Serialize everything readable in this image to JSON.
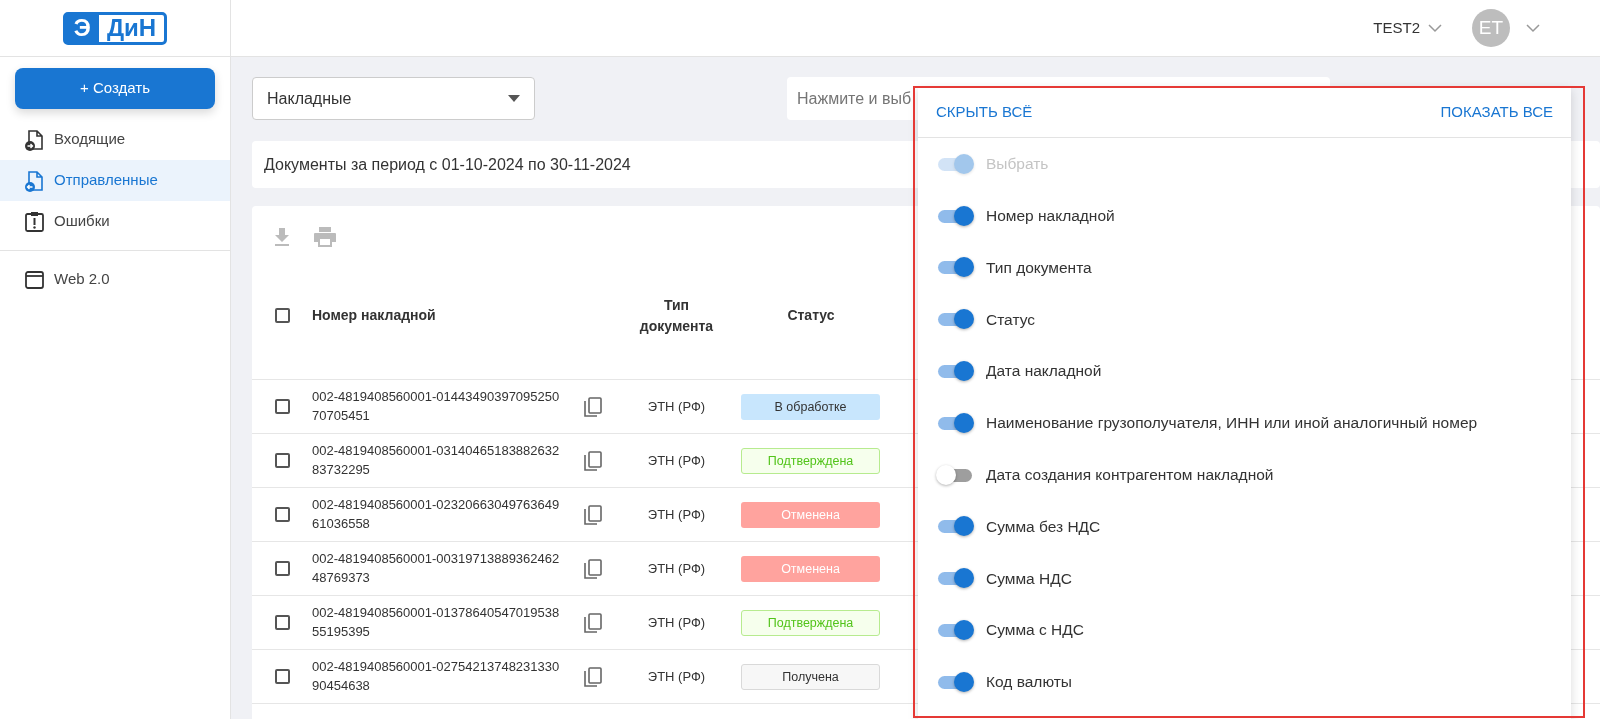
{
  "logo": {
    "left": "Э",
    "right": "ДиН"
  },
  "header": {
    "account": "TEST2",
    "avatar": "ET"
  },
  "sidebar": {
    "create_button": "+ Создать",
    "items": [
      {
        "label": "Входящие",
        "kind": "incoming",
        "selected": false
      },
      {
        "label": "Отправленные",
        "kind": "outgoing",
        "selected": true
      },
      {
        "label": "Ошибки",
        "kind": "errors",
        "selected": false
      },
      {
        "label": "Web 2.0",
        "kind": "web",
        "selected": false
      }
    ]
  },
  "filters": {
    "doc_type": "Накладные",
    "search": {
      "placeholder": "Нажмите и выб"
    }
  },
  "period": "Документы за период с 01-10-2024 по 30-11-2024",
  "table": {
    "select_all_checked": false,
    "columns": [
      "Номер накладной",
      "Тип документа",
      "Статус"
    ],
    "rows": [
      {
        "checked": false,
        "number": "002-4819408560001-01443490397095250 70705451",
        "type": "ЭТН (РФ)",
        "status": "В обработке",
        "kind": "processing"
      },
      {
        "checked": false,
        "number": "002-4819408560001-03140465183882632 83732295",
        "type": "ЭТН (РФ)",
        "status": "Подтверждена",
        "kind": "confirmed"
      },
      {
        "checked": false,
        "number": "002-4819408560001-02320663049763649 61036558",
        "type": "ЭТН (РФ)",
        "status": "Отменена",
        "kind": "cancelled"
      },
      {
        "checked": false,
        "number": "002-4819408560001-00319713889362462 48769373",
        "type": "ЭТН (РФ)",
        "status": "Отменена",
        "kind": "cancelled"
      },
      {
        "checked": false,
        "number": "002-4819408560001-01378640547019538 55195395",
        "type": "ЭТН (РФ)",
        "status": "Подтверждена",
        "kind": "confirmed"
      },
      {
        "checked": false,
        "number": "002-4819408560001-02754213748231330 90454638",
        "type": "ЭТН (РФ)",
        "status": "Получена",
        "kind": "received"
      }
    ]
  },
  "columns_panel": {
    "hide_all": "СКРЫТЬ ВСЁ",
    "show_all": "ПОКАЗАТЬ ВСЕ",
    "items": [
      {
        "label": "Выбрать",
        "on": true,
        "disabled": true
      },
      {
        "label": "Номер накладной",
        "on": true,
        "disabled": false
      },
      {
        "label": "Тип документа",
        "on": true,
        "disabled": false
      },
      {
        "label": "Статус",
        "on": true,
        "disabled": false
      },
      {
        "label": "Дата накладной",
        "on": true,
        "disabled": false
      },
      {
        "label": "Наименование грузополучателя, ИНН или иной аналогичный номер",
        "on": true,
        "disabled": false
      },
      {
        "label": "Дата создания контрагентом накладной",
        "on": false,
        "disabled": false
      },
      {
        "label": "Сумма без НДС",
        "on": true,
        "disabled": false
      },
      {
        "label": "Сумма НДС",
        "on": true,
        "disabled": false
      },
      {
        "label": "Сумма с НДС",
        "on": true,
        "disabled": false
      },
      {
        "label": "Код валюты",
        "on": true,
        "disabled": false
      }
    ]
  }
}
